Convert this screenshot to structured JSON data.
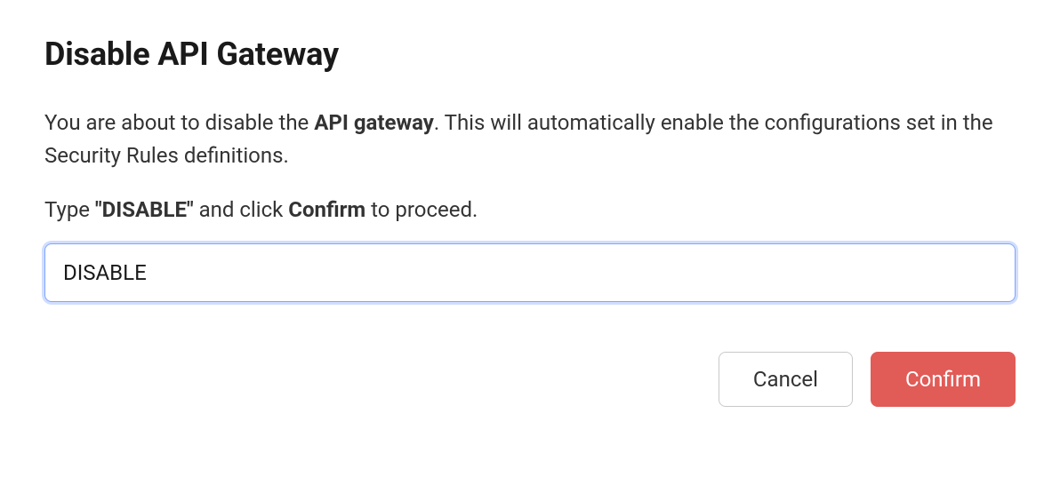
{
  "dialog": {
    "title": "Disable API Gateway",
    "message_pre": "You are about to disable the ",
    "message_bold": "API gateway",
    "message_post": ". This will automatically enable the configurations set in the Security Rules definitions.",
    "instruction_pre": "Type ",
    "instruction_keyword": "\"DISABLE\"",
    "instruction_mid": " and click ",
    "instruction_action": "Confirm",
    "instruction_post": " to proceed.",
    "input_value": "DISABLE",
    "buttons": {
      "cancel": "Cancel",
      "confirm": "Confirm"
    }
  }
}
